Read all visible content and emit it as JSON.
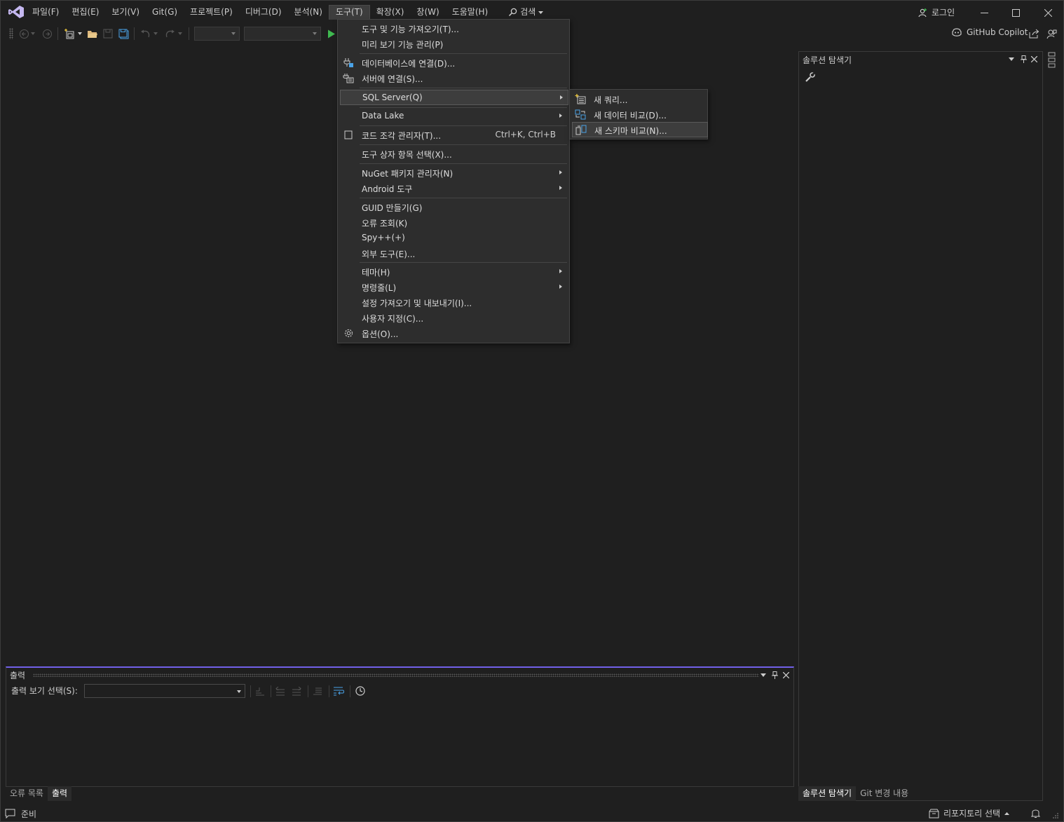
{
  "menubar": {
    "items": [
      "파일(F)",
      "편집(E)",
      "보기(V)",
      "Git(G)",
      "프로젝트(P)",
      "디버그(D)",
      "분석(N)",
      "도구(T)",
      "확장(X)",
      "창(W)",
      "도움말(H)"
    ],
    "active_index": 7,
    "search_label": "검색",
    "login_label": "로그인"
  },
  "toolbar": {
    "copilot_label": "GitHub Copilot"
  },
  "tools_menu": {
    "items": [
      {
        "label": "도구 및 기능 가져오기(T)..."
      },
      {
        "label": "미리 보기 기능 관리(P)"
      },
      {
        "label": "데이터베이스에 연결(D)...",
        "icon": "database-connect-icon"
      },
      {
        "label": "서버에 연결(S)...",
        "icon": "server-connect-icon"
      },
      {
        "label": "SQL Server(Q)",
        "submenu": true
      },
      {
        "label": "Data Lake",
        "submenu": true
      },
      {
        "label": "코드 조각 관리자(T)...",
        "shortcut": "Ctrl+K, Ctrl+B",
        "icon": "code-snippet-icon"
      },
      {
        "label": "도구 상자 항목 선택(X)..."
      },
      {
        "label": "NuGet 패키지 관리자(N)",
        "submenu": true
      },
      {
        "label": "Android 도구",
        "submenu": true
      },
      {
        "label": "GUID 만들기(G)"
      },
      {
        "label": "오류 조회(K)"
      },
      {
        "label": "Spy++(+)"
      },
      {
        "label": "외부 도구(E)..."
      },
      {
        "label": "테마(H)",
        "submenu": true
      },
      {
        "label": "명령줄(L)",
        "submenu": true
      },
      {
        "label": "설정 가져오기 및 내보내기(I)..."
      },
      {
        "label": "사용자 지정(C)..."
      },
      {
        "label": "옵션(O)...",
        "icon": "gear-icon"
      }
    ]
  },
  "sql_submenu": {
    "items": [
      {
        "label": "새 쿼리...",
        "icon": "new-query-icon"
      },
      {
        "label": "새 데이터 비교(D)...",
        "icon": "data-compare-icon"
      },
      {
        "label": "새 스키마 비교(N)...",
        "icon": "schema-compare-icon"
      }
    ]
  },
  "solution_explorer": {
    "title": "솔루션 탐색기",
    "tabs": [
      "솔루션 탐색기",
      "Git 변경 내용"
    ],
    "side_label": "알림"
  },
  "output_panel": {
    "title": "출력",
    "source_label": "출력 보기 선택(S):",
    "source_value": "",
    "tabs": [
      "오류 목록",
      "출력"
    ]
  },
  "statusbar": {
    "status": "준비",
    "repo_label": "리포지토리 선택"
  },
  "colors": {
    "accent": "#7160e8",
    "background": "#1f1f1f",
    "menu_bg": "#2d2d2d",
    "run_green": "#3fb950"
  }
}
